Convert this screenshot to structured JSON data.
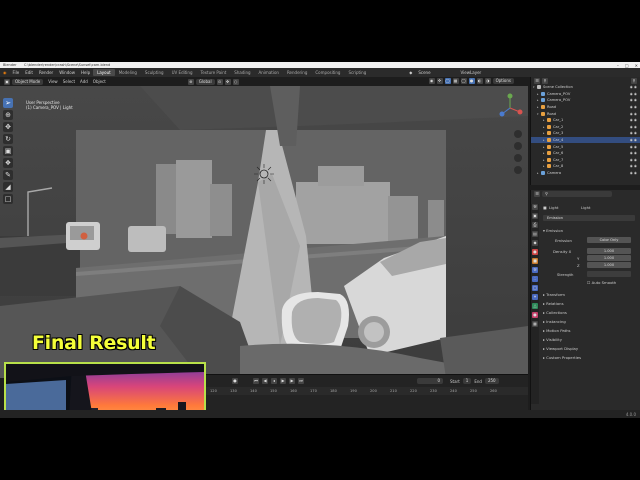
{
  "titlebar": {
    "app": "Blender",
    "path": "C:\\blender\\render\\crash\\Scene\\Sunset\\cam.blend"
  },
  "menu": {
    "items": [
      "File",
      "Edit",
      "Render",
      "Window",
      "Help"
    ],
    "workspaces": [
      "Layout",
      "Modeling",
      "Sculpting",
      "UV Editing",
      "Texture Paint",
      "Shading",
      "Animation",
      "Rendering",
      "Compositing",
      "Scripting"
    ],
    "scene_label": "Scene",
    "view_layer_label": "ViewLayer"
  },
  "viewport_header": {
    "mode": "Object Mode",
    "menus": [
      "View",
      "Select",
      "Add",
      "Object"
    ],
    "transform": "Global",
    "options": "Options"
  },
  "viewport": {
    "view_name": "User Perspective",
    "collection_info": "(1) Camera_POV | Light"
  },
  "overlay": {
    "final_label": "Final Result"
  },
  "outliner": {
    "rows": [
      {
        "name": "Scene Collection",
        "indent": 0,
        "color": "#bbbbbb",
        "selected": false
      },
      {
        "name": "Camera_POV",
        "indent": 1,
        "color": "#6aa0d8",
        "selected": false
      },
      {
        "name": "Camera_POV",
        "indent": 1,
        "color": "#6aa0d8",
        "selected": false
      },
      {
        "name": "Road",
        "indent": 1,
        "color": "#e8a040",
        "selected": false
      },
      {
        "name": "Road",
        "indent": 1,
        "color": "#e8a040",
        "selected": false
      },
      {
        "name": "Car_1",
        "indent": 2,
        "color": "#e8a040",
        "selected": false
      },
      {
        "name": "Car_2",
        "indent": 2,
        "color": "#e8a040",
        "selected": false
      },
      {
        "name": "Car_3",
        "indent": 2,
        "color": "#e8a040",
        "selected": false
      },
      {
        "name": "Car_4",
        "indent": 2,
        "color": "#e8a040",
        "selected": true
      },
      {
        "name": "Car_5",
        "indent": 2,
        "color": "#e8a040",
        "selected": false
      },
      {
        "name": "Car_6",
        "indent": 2,
        "color": "#e8a040",
        "selected": false
      },
      {
        "name": "Car_7",
        "indent": 2,
        "color": "#e8a040",
        "selected": false
      },
      {
        "name": "Car_8",
        "indent": 2,
        "color": "#e8a040",
        "selected": false
      },
      {
        "name": "Camera",
        "indent": 1,
        "color": "#6aa0d8",
        "selected": false
      }
    ]
  },
  "properties": {
    "object_name": "Light",
    "data_name": "Light",
    "section": "Emission",
    "subsection": "Emission",
    "fields": {
      "emission_label": "Emission",
      "emission_value": "Color Only",
      "density_x_label": "Density X",
      "density_x": "1.000",
      "density_y_label": "Y",
      "density_y": "1.000",
      "density_z_label": "Z",
      "density_z": "1.000",
      "strength_label": "Strength",
      "auto_label": "Auto Smooth"
    },
    "panels": [
      "Transform",
      "Relations",
      "Collections",
      "Instancing",
      "Motion Paths",
      "Visibility",
      "Viewport Display",
      "Custom Properties"
    ]
  },
  "timeline": {
    "current_frame": "0",
    "start_label": "Start",
    "start": "1",
    "end_label": "End",
    "end": "250",
    "ticks": [
      "120",
      "130",
      "140",
      "150",
      "160",
      "170",
      "180",
      "190",
      "200",
      "210",
      "220",
      "230",
      "240",
      "250",
      "260"
    ]
  },
  "status": {
    "version": "4.0.0"
  },
  "colors": {
    "accent": "#4772b3",
    "label_yellow": "#f5ff3a",
    "frame_green": "#b8e04a"
  }
}
